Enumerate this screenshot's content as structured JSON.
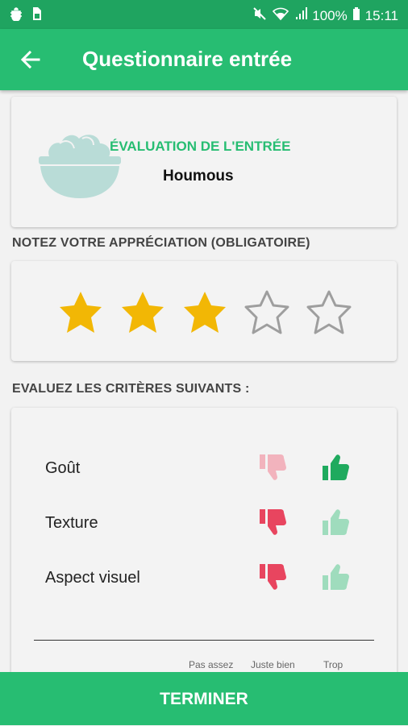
{
  "status_bar": {
    "signal_label": "",
    "battery_text": "100%",
    "time": "15:11"
  },
  "appbar": {
    "title": "Questionnaire entrée",
    "back_icon": "arrow-left-icon"
  },
  "dish_card": {
    "section_label": "ÉVALUATION DE L'ENTRÉE",
    "dish_name": "Houmous",
    "image_icon": "salad-bowl-icon"
  },
  "rating": {
    "title": "NOTEZ VOTRE APPRÉCIATION (OBLIGATOIRE)",
    "value": 3,
    "max": 5,
    "filled_color": "#f2b705",
    "empty_color": "#9e9e9e"
  },
  "criteria": {
    "title": "EVALUEZ LES CRITÈRES SUIVANTS :",
    "items": [
      {
        "label": "Goût",
        "selected": "up"
      },
      {
        "label": "Texture",
        "selected": "down"
      },
      {
        "label": "Aspect visuel",
        "selected": "down"
      }
    ],
    "colors": {
      "down_active": "#e8455f",
      "down_inactive": "#f2b3bd",
      "up_active": "#1faa5e",
      "up_inactive": "#9fdcbd"
    },
    "scale_labels": [
      "Pas assez",
      "Juste bien",
      "Trop"
    ]
  },
  "footer": {
    "finish_label": "TERMINER"
  }
}
